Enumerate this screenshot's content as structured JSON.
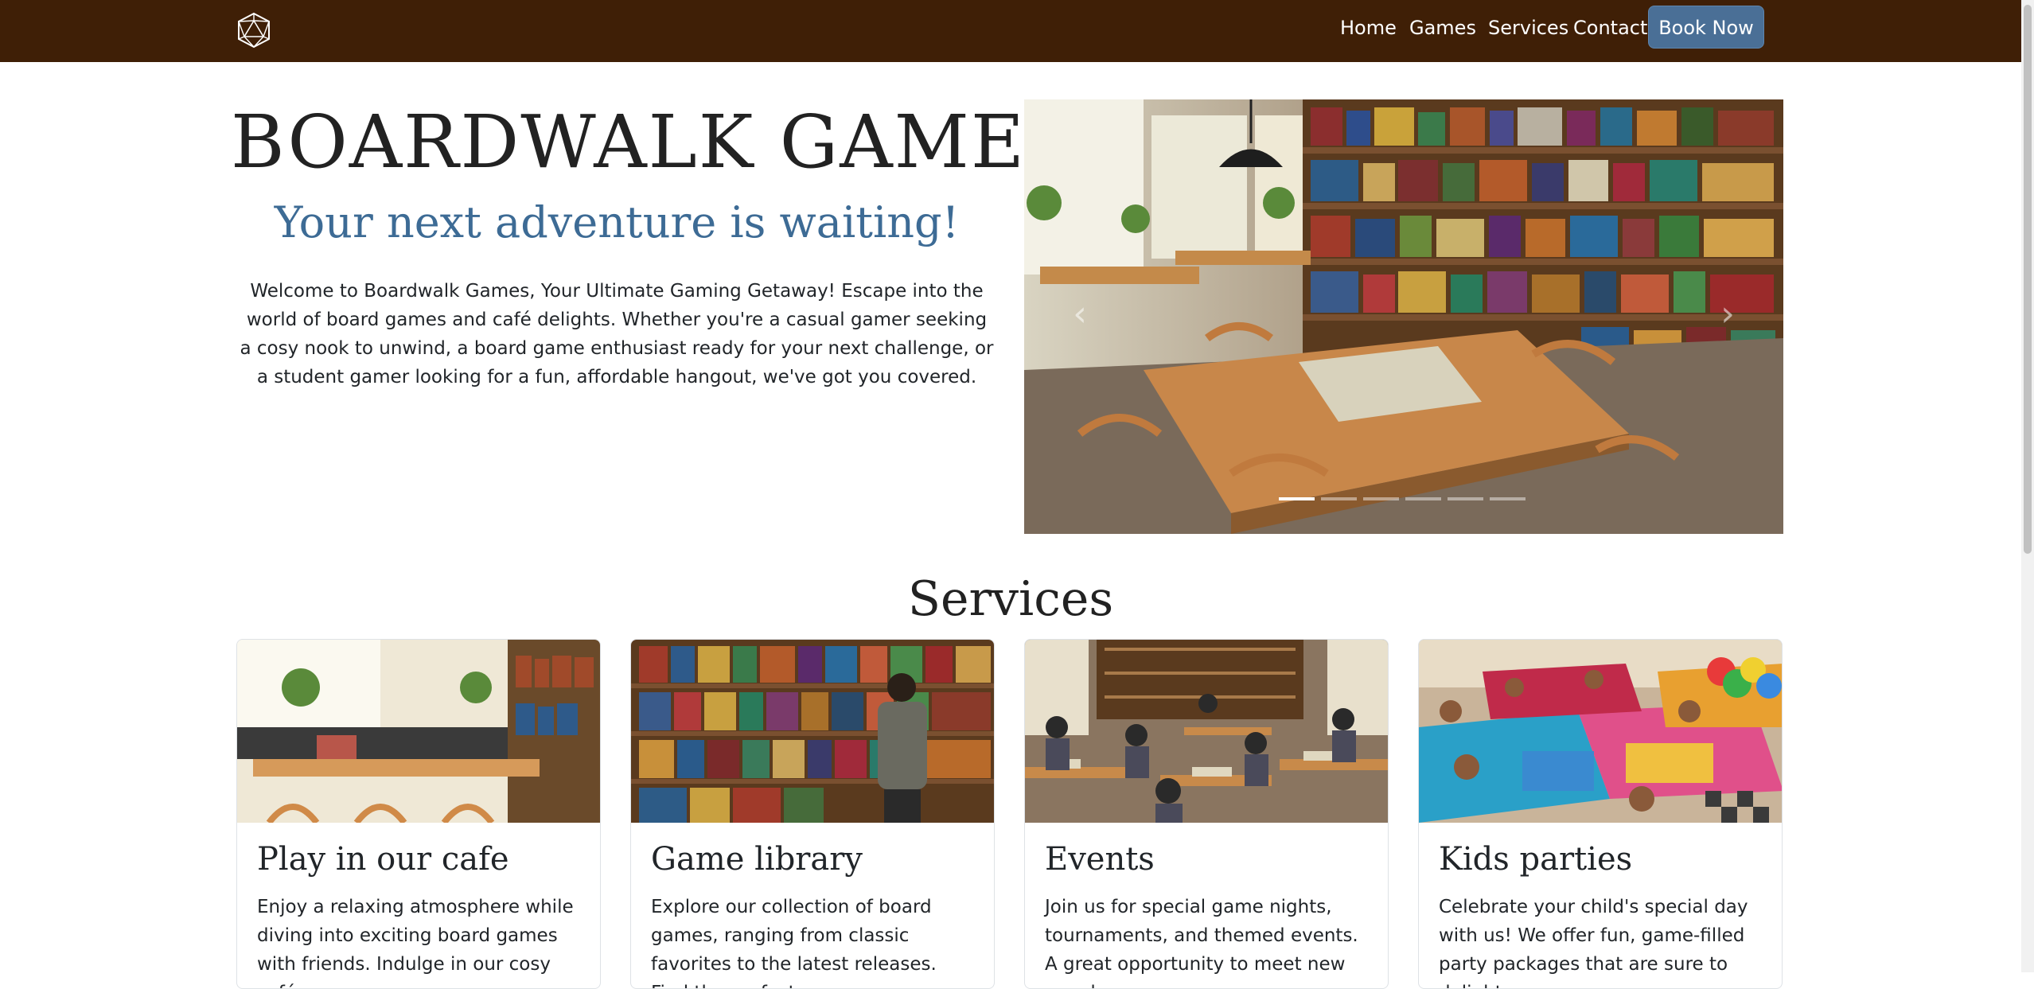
{
  "nav": {
    "logo_icon": "d20-dice-icon",
    "links": [
      {
        "label": "Home"
      },
      {
        "label": "Games"
      },
      {
        "label": "Services"
      },
      {
        "label": "Contact"
      }
    ],
    "book_label": "Book Now",
    "colors": {
      "navbar_bg": "#3f1f06",
      "button_bg": "#4a6f96"
    }
  },
  "hero": {
    "title": "BOARDWALK GAMES",
    "subtitle": "Your next adventure is waiting!",
    "text": "Welcome to Boardwalk Games, Your Ultimate Gaming Getaway! Escape into the world of board games and café delights. Whether you're a casual gamer seeking a cosy nook to unwind, a board game enthusiast ready for your next challenge, or a student gamer looking for a fun, affordable hangout, we've got you covered."
  },
  "carousel": {
    "slide_count": 6,
    "active_slide": 1,
    "prev_icon": "chevron-left-icon",
    "next_icon": "chevron-right-icon"
  },
  "services": {
    "title": "Services",
    "cards": [
      {
        "title": "Play in our cafe",
        "text": "Enjoy a relaxing atmosphere while diving into exciting board games with friends. Indulge in our cosy café"
      },
      {
        "title": "Game library",
        "text": "Explore our collection of board games, ranging from classic favorites to the latest releases. Find the perfect game"
      },
      {
        "title": "Events",
        "text": "Join us for special game nights, tournaments, and themed events. A great opportunity to meet new people"
      },
      {
        "title": "Kids parties",
        "text": "Celebrate your child's special day with us! We offer fun, game-filled party packages that are sure to delight"
      }
    ]
  }
}
